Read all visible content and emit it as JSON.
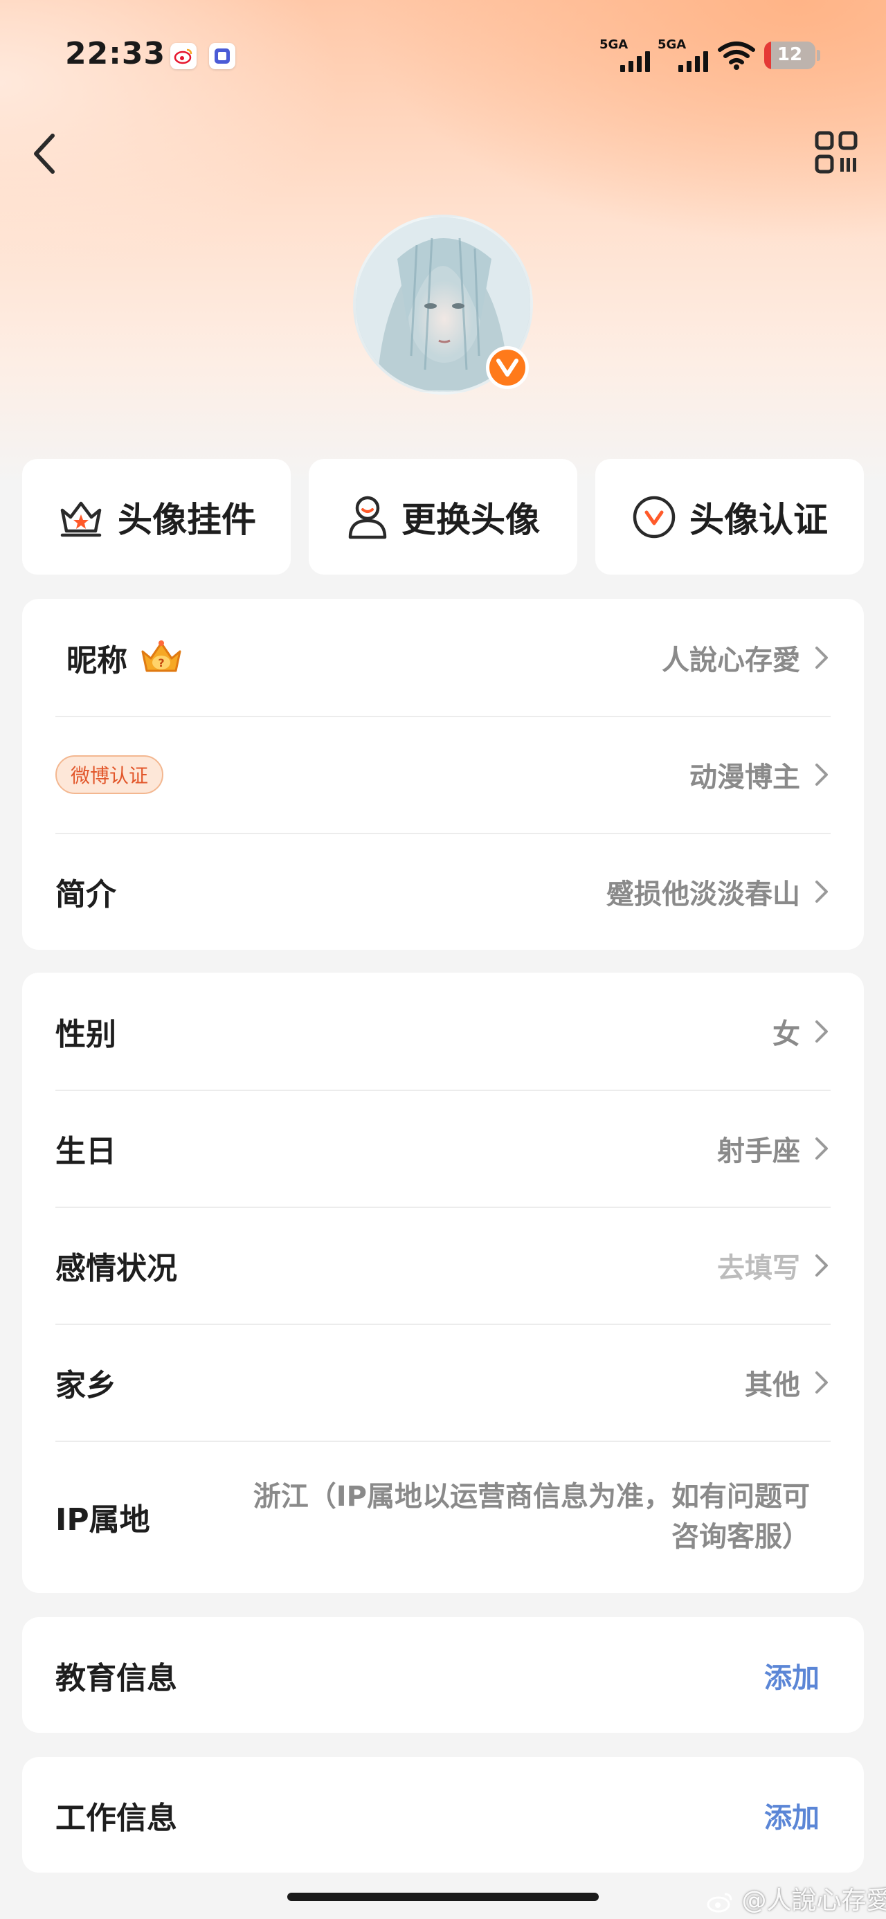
{
  "status_bar": {
    "time": "22:33",
    "network_1": "5GA",
    "network_2": "5GA",
    "battery": "12"
  },
  "header": {
    "back_icon": "chevron-left-icon",
    "qr_icon": "qr-code-icon"
  },
  "avatar": {
    "verified_icon": "v-badge-icon"
  },
  "actions": [
    {
      "label": "头像挂件",
      "icon": "crown-frame-icon"
    },
    {
      "label": "更换头像",
      "icon": "person-icon"
    },
    {
      "label": "头像认证",
      "icon": "v-circle-icon"
    }
  ],
  "profile": {
    "nickname_label": "昵称",
    "nickname_value": "人說心存愛",
    "verify_badge": "微博认证",
    "verify_value": "动漫博主",
    "bio_label": "简介",
    "bio_value": "蹙损他淡淡春山"
  },
  "details": {
    "gender_label": "性别",
    "gender_value": "女",
    "birthday_label": "生日",
    "birthday_value": "射手座",
    "relationship_label": "感情状况",
    "relationship_value": "去填写",
    "hometown_label": "家乡",
    "hometown_value": "其他",
    "ip_label": "IP属地",
    "ip_value": "浙江（IP属地以运营商信息为准，如有问题可咨询客服）"
  },
  "education": {
    "label": "教育信息",
    "action": "添加"
  },
  "work": {
    "label": "工作信息",
    "action": "添加"
  },
  "watermark": "@人說心存愛",
  "colors": {
    "accent_orange": "#ff7a1a",
    "link_blue": "#5b86d6",
    "hero_peach": "#ffc8a8"
  }
}
